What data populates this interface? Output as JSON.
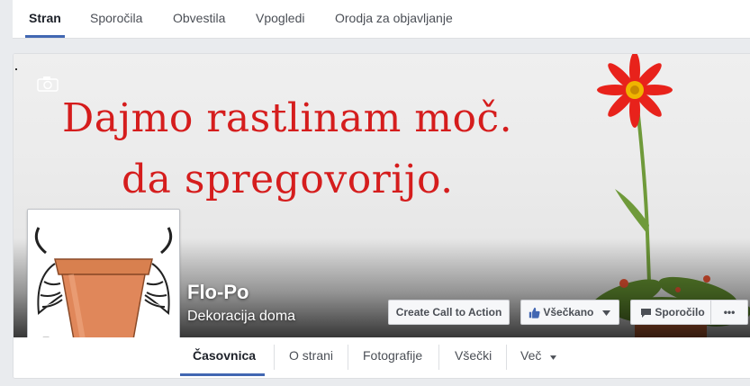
{
  "admin_tabs": [
    {
      "label": "Stran",
      "active": true
    },
    {
      "label": "Sporočila"
    },
    {
      "label": "Obvestila"
    },
    {
      "label": "Vpogledi"
    },
    {
      "label": "Orodja za objavljanje"
    }
  ],
  "cover": {
    "line1": "Dajmo rastlinam moč.",
    "line2": "da spregovorijo.",
    "text_color": "#d51d1d"
  },
  "page": {
    "name": "Flo-Po",
    "category": "Dekoracija doma"
  },
  "actions": {
    "cta": "Create Call to Action",
    "liked": "Všečkano",
    "message": "Sporočilo",
    "more": "•••"
  },
  "nav": [
    {
      "label": "Časovnica",
      "active": true
    },
    {
      "label": "O strani"
    },
    {
      "label": "Fotografije"
    },
    {
      "label": "Všečki"
    },
    {
      "label": "Več"
    }
  ],
  "colors": {
    "accent": "#4267b2",
    "flower": "#e8221b"
  }
}
